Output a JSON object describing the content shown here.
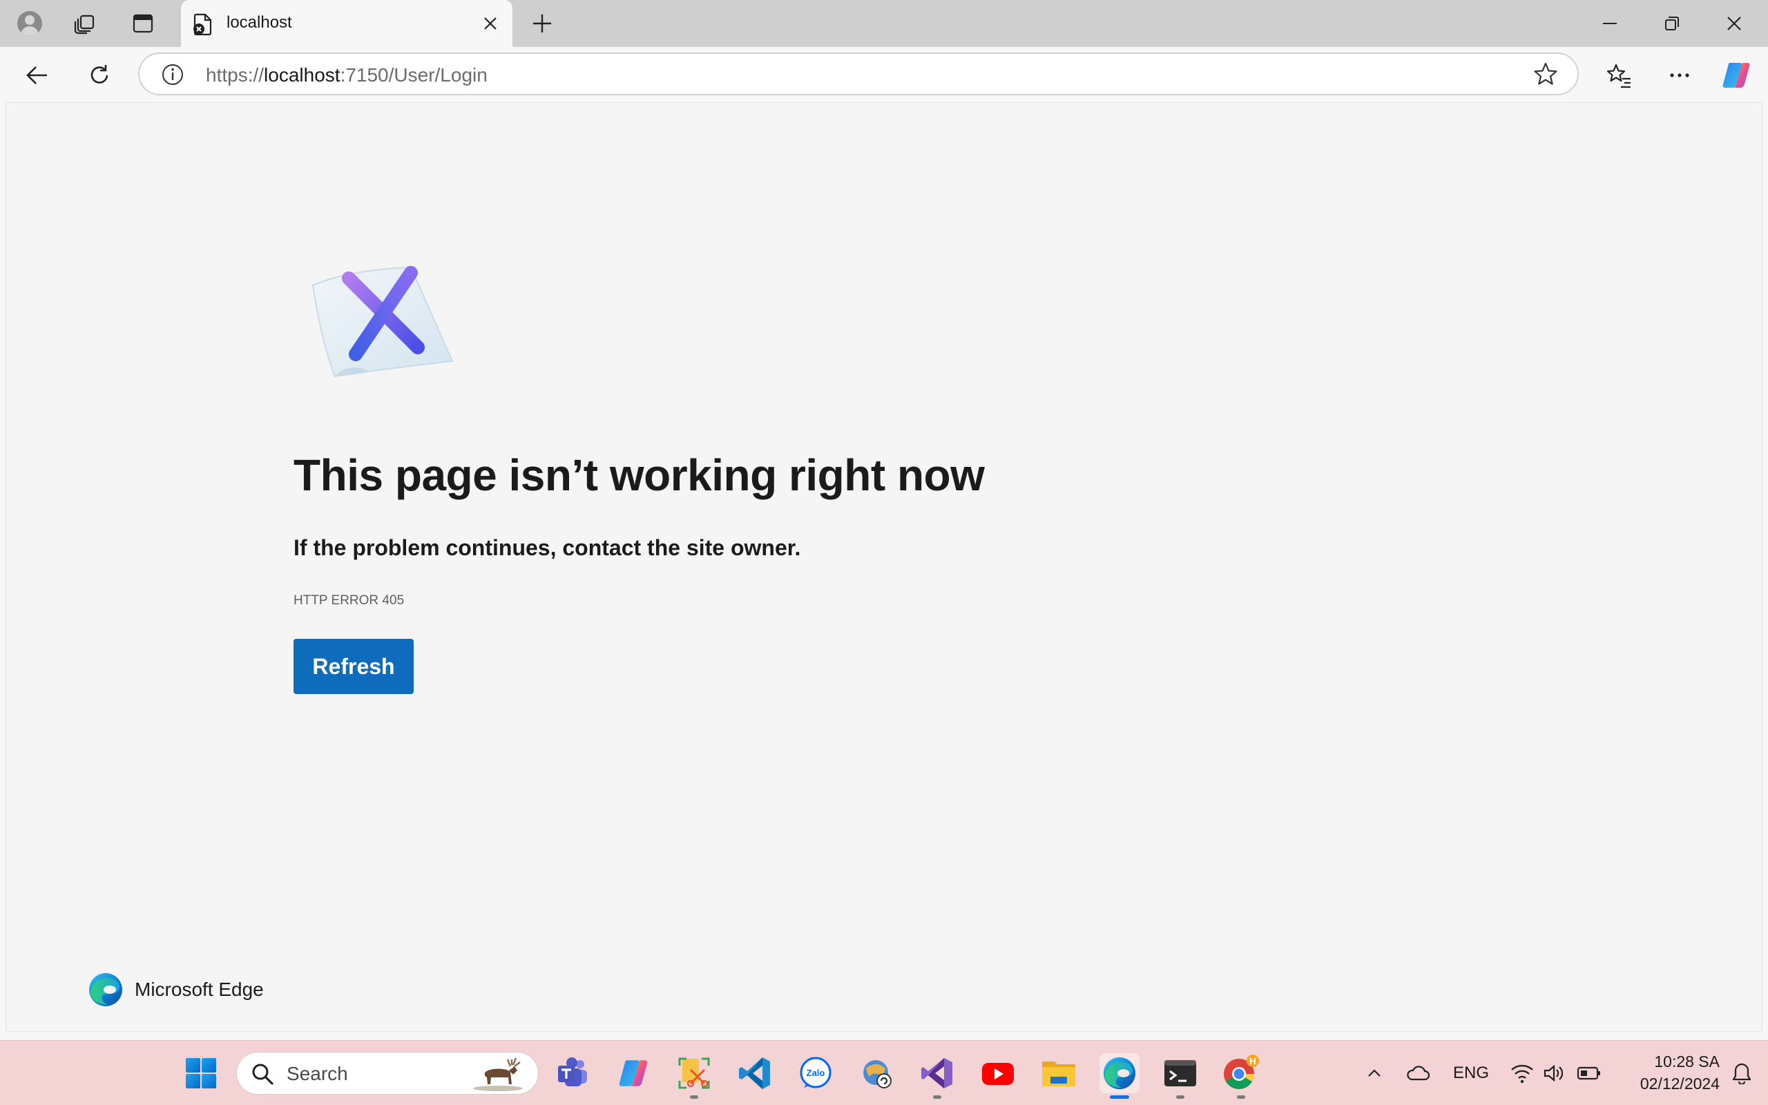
{
  "browser": {
    "tab": {
      "title": "localhost"
    },
    "address": {
      "scheme": "https://",
      "host": "localhost",
      "rest": ":7150/User/Login"
    }
  },
  "error_page": {
    "heading": "This page isn’t working right now",
    "subtext": "If the problem continues, contact the site owner.",
    "code": "HTTP ERROR 405",
    "refresh_label": "Refresh",
    "brand": "Microsoft Edge"
  },
  "taskbar": {
    "search_placeholder": "Search",
    "apps": [
      "start-icon",
      "teams-icon",
      "copilot-icon",
      "snipping-tool-icon",
      "vscode-icon",
      "zalo-icon",
      "unikey-icon",
      "visual-studio-icon",
      "youtube-icon",
      "file-explorer-icon",
      "edge-icon",
      "terminal-icon",
      "chrome-icon"
    ],
    "zalo_label": "Zalo",
    "tray": {
      "language": "ENG",
      "time": "10:28 SA",
      "date": "02/12/2024"
    }
  },
  "colors": {
    "accent": "#0f6cbd",
    "taskbar_bg": "#f4d3d4",
    "titlebar_bg": "#cfcfcf",
    "page_bg": "#f5f5f5"
  }
}
